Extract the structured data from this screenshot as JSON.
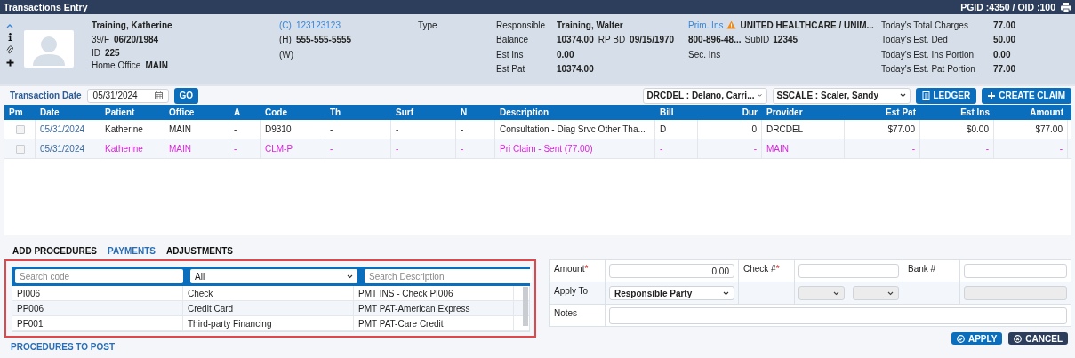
{
  "window": {
    "title": "Transactions Entry",
    "ids": "PGID :4350  /  OID :100"
  },
  "patient": {
    "name": "Training, Katherine",
    "age_sex": "39/F",
    "dob": "06/20/1984",
    "id_label": "ID",
    "id": "225",
    "office_label": "Home Office",
    "office": "MAIN"
  },
  "phones": [
    {
      "label": "(C)",
      "value": "123123123",
      "link": true
    },
    {
      "label": "(H)",
      "value": "555-555-5555",
      "link": false
    },
    {
      "label": "(W)",
      "link": false
    }
  ],
  "type_label": "Type",
  "responsible": [
    {
      "label": "Responsible",
      "value": "Training, Walter"
    },
    {
      "label": "Balance",
      "value": "10374.00",
      "extra_label": "RP BD",
      "extra": "09/15/1970"
    },
    {
      "label": "Est Ins",
      "value": "0.00"
    },
    {
      "label": "Est Pat",
      "value": "10374.00"
    }
  ],
  "insurance": {
    "primary_label": "Prim. Ins",
    "warning": true,
    "primary": "UNITED HEALTHCARE / UNIM...",
    "phone": "800-896-48...",
    "subid_label": "SubID",
    "subid": "12345",
    "secondary_label": "Sec. Ins"
  },
  "totals": [
    {
      "label": "Today's Total Charges",
      "value": "77.00"
    },
    {
      "label": "Today's Est. Ded",
      "value": "50.00"
    },
    {
      "label": "Today's Est. Ins Portion",
      "value": "0.00"
    },
    {
      "label": "Today's Est. Pat Portion",
      "value": "77.00"
    }
  ],
  "toolbar": {
    "date_label": "Transaction Date",
    "date": "05/31/2024",
    "go": "GO",
    "provider": "DRCDEL : Delano, Carri...",
    "hygienist": "SSCALE : Scaler, Sandy",
    "ledger": "LEDGER",
    "create_claim": "CREATE CLAIM"
  },
  "table": {
    "columns": [
      "Pm",
      "Date",
      "Patient",
      "Office",
      "A",
      "Code",
      "Th",
      "Surf",
      "N",
      "Description",
      "Bill",
      "Dur",
      "Provider",
      "Est Pat",
      "Est Ins",
      "Amount"
    ],
    "rows": [
      {
        "kind": "procedure",
        "checked": false,
        "cells": [
          "",
          "05/31/2024",
          "Katherine",
          "MAIN",
          "-",
          "D9310",
          "-",
          "-",
          "-",
          "Consultation - Diag Srvc Other Tha...",
          "D",
          "0",
          "DRCDEL",
          "$77.00",
          "$0.00",
          "$77.00"
        ]
      },
      {
        "kind": "claim",
        "checked": false,
        "cells": [
          "",
          "05/31/2024",
          "Katherine",
          "MAIN",
          "-",
          "CLM-P",
          "-",
          "-",
          "-",
          "Pri Claim - Sent (77.00)",
          "-",
          "-",
          "MAIN",
          "-",
          "-",
          "-"
        ]
      }
    ]
  },
  "tabs": [
    {
      "label": "ADD PROCEDURES",
      "selected": false
    },
    {
      "label": "PAYMENTS",
      "selected": true
    },
    {
      "label": "ADJUSTMENTS",
      "selected": false
    }
  ],
  "payment_search": {
    "code_placeholder": "Search code",
    "filter": "All",
    "description_placeholder": "Search Description",
    "rows": [
      [
        "PI006",
        "Check",
        "PMT INS - Check PI006"
      ],
      [
        "PP006",
        "Credit Card",
        "PMT PAT-American Express"
      ],
      [
        "PF001",
        "Third-party Financing",
        "PMT PAT-Care Credit"
      ]
    ]
  },
  "payment_form": {
    "amount_label": "Amount",
    "required_mark": "*",
    "amount": "0.00",
    "check_label": "Check #",
    "bank_label": "Bank #",
    "apply_to_label": "Apply To",
    "apply_to": "Responsible Party",
    "notes_label": "Notes"
  },
  "procedures_to_post": "PROCEDURES TO POST",
  "buttons": [
    {
      "kind": "apply",
      "label": "APPLY"
    },
    {
      "kind": "cancel",
      "label": "CANCEL"
    }
  ]
}
